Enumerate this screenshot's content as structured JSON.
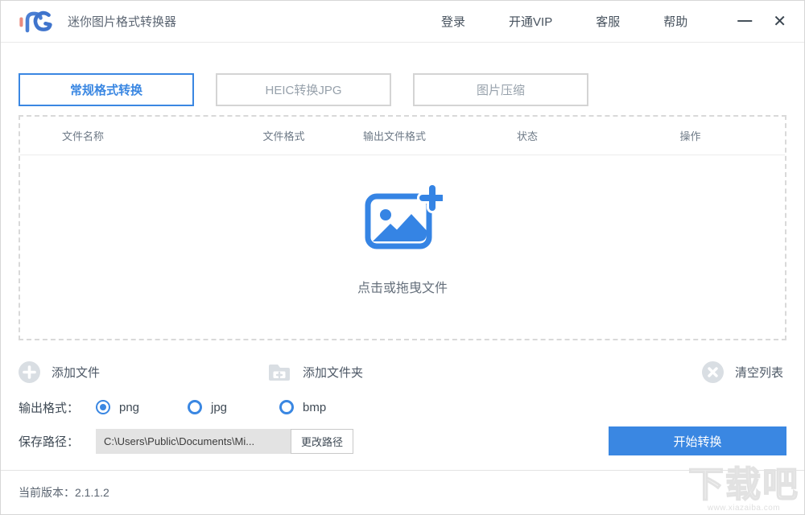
{
  "header": {
    "title": "迷你图片格式转换器",
    "menu": [
      "登录",
      "开通VIP",
      "客服",
      "帮助"
    ],
    "minimize": "—",
    "close": "✕"
  },
  "tabs": [
    {
      "label": "常规格式转换",
      "active": true
    },
    {
      "label": "HEIC转换JPG",
      "active": false
    },
    {
      "label": "图片压缩",
      "active": false
    }
  ],
  "table": {
    "columns": [
      "文件名称",
      "文件格式",
      "输出文件格式",
      "状态",
      "操作"
    ]
  },
  "dropzone": {
    "hint": "点击或拖曳文件"
  },
  "actions": {
    "add_file": "添加文件",
    "add_folder": "添加文件夹",
    "clear_list": "清空列表"
  },
  "output_format": {
    "label": "输出格式：",
    "options": [
      {
        "label": "png",
        "selected": true
      },
      {
        "label": "jpg",
        "selected": false
      },
      {
        "label": "bmp",
        "selected": false
      }
    ]
  },
  "save_path": {
    "label": "保存路径：",
    "value": "C:\\Users\\Public\\Documents\\Mi...",
    "change_button": "更改路径"
  },
  "convert_button_label": "开始转换",
  "footer": {
    "version": "当前版本：2.1.1.2"
  },
  "watermark": {
    "text": "下载吧",
    "url": "www.xiazaiba.com"
  },
  "colors": {
    "accent": "#3a87e2",
    "inactive_border": "#d4d4d4",
    "dashed_border": "#d9d9d9",
    "icon_gray": "#d9dee3",
    "logo_red": "#e98b7e",
    "path_field_bg": "#e3e3e3"
  }
}
